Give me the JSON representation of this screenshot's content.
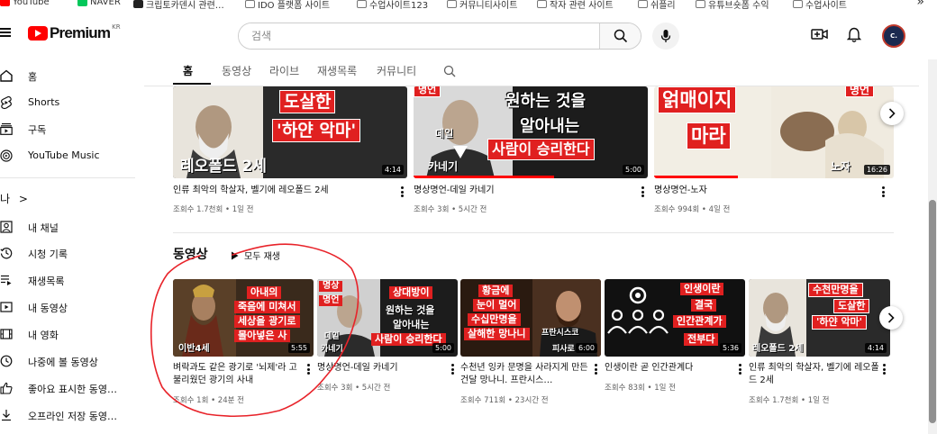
{
  "bookmarks": {
    "items": [
      {
        "label": "YouTube",
        "icon": "youtube-icon"
      },
      {
        "label": "NAVER",
        "icon": "naver-icon"
      },
      {
        "label": "크립토카덴시 관련…",
        "icon": "bookmark-icon"
      },
      {
        "label": "IDO 플랫폼 사이트",
        "icon": "folder-icon"
      },
      {
        "label": "수업사이트123",
        "icon": "folder-icon"
      },
      {
        "label": "커뮤니티사이트",
        "icon": "folder-icon"
      },
      {
        "label": "작자 관련 사이트",
        "icon": "folder-icon"
      },
      {
        "label": "쉬플리",
        "icon": "folder-icon"
      },
      {
        "label": "유튜브숏폼 수익",
        "icon": "folder-icon"
      },
      {
        "label": "수업사이트",
        "icon": "folder-icon"
      }
    ],
    "more": "»"
  },
  "header": {
    "logo_text": "Premium",
    "logo_region": "KR",
    "search_placeholder": "검색",
    "avatar_text": "C."
  },
  "sidebar": {
    "top_items": [
      {
        "label": "홈",
        "icon": "home-icon"
      },
      {
        "label": "Shorts",
        "icon": "shorts-icon"
      },
      {
        "label": "구독",
        "icon": "subscriptions-icon"
      },
      {
        "label": "YouTube Music",
        "icon": "youtube-music-icon"
      }
    ],
    "you_label": "나",
    "you_chevron": ">",
    "you_items": [
      {
        "label": "내 채널",
        "icon": "channel-icon"
      },
      {
        "label": "시청 기록",
        "icon": "history-icon"
      },
      {
        "label": "재생목록",
        "icon": "playlists-icon"
      },
      {
        "label": "내 동영상",
        "icon": "your-videos-icon"
      },
      {
        "label": "내 영화",
        "icon": "movies-icon"
      },
      {
        "label": "나중에 볼 동영상",
        "icon": "watch-later-icon"
      },
      {
        "label": "좋아요 표시한 동영…",
        "icon": "liked-icon"
      },
      {
        "label": "오프라인 저장 동영…",
        "icon": "download-icon"
      }
    ]
  },
  "tabs": [
    {
      "label": "홈",
      "active": true
    },
    {
      "label": "동영상",
      "active": false
    },
    {
      "label": "라이브",
      "active": false
    },
    {
      "label": "재생목록",
      "active": false
    },
    {
      "label": "커뮤니티",
      "active": false
    }
  ],
  "top_row": [
    {
      "thumb_lines": [
        "도살한",
        "'하얀 악마'",
        "레오폴드 2세"
      ],
      "duration": "4:14",
      "title": "인류 최악의 학살자, 벨기에 레오폴드 2세",
      "meta": "조회수 1.7천회 • 1일 전",
      "progress": 0.0
    },
    {
      "thumb_lines": [
        "원하는 것을",
        "알아내는",
        "사람이 승리한다",
        "데일",
        "카네기",
        "명언"
      ],
      "duration": "5:00",
      "title": "명상명언-데일 카네기",
      "meta": "조회수 3회 • 5시간 전",
      "progress": 0.6
    },
    {
      "thumb_lines": [
        "얽매이지",
        "마라",
        "노자",
        "명언"
      ],
      "duration": "16:26",
      "title": "명상명언-노자",
      "meta": "조회수 994회 • 4일 전",
      "progress": 0.35
    }
  ],
  "videos_section": {
    "title": "동영상",
    "play_all": "모두 재생"
  },
  "bottom_row": [
    {
      "thumb_lines": [
        "아내의",
        "죽음에 미쳐서",
        "세상을 광기로",
        "몰아넣은 사",
        "이반4세"
      ],
      "duration": "5:55",
      "title": "벼락과도 같은 광기로 '뇌제'라 고 불리웠던 광기의 사내",
      "meta": "조회수 1회 • 24분 전"
    },
    {
      "thumb_lines": [
        "명상",
        "명언",
        "상대방이",
        "원하는 것을",
        "알아내는",
        "사람이 승리한다",
        "데일",
        "카네기"
      ],
      "duration": "5:00",
      "title": "명상명언-데일 카네기",
      "meta": "조회수 3회 • 5시간 전"
    },
    {
      "thumb_lines": [
        "황금에",
        "눈이 멀어",
        "수십만명을",
        "살해한 망나니",
        "프란시스코",
        "피사로"
      ],
      "duration": "6:00",
      "title": "수천년 잉카 문명을 사라지게 만든 건달 망나니. 프란시스…",
      "meta": "조회수 711회 • 23시간 전"
    },
    {
      "thumb_lines": [
        "인생이란",
        "결국",
        "인간관계가",
        "전부다"
      ],
      "duration": "5:36",
      "title": "인생이란 곧 인간관계다",
      "meta": "조회수 83회 • 1일 전"
    },
    {
      "thumb_lines": [
        "수천만명을",
        "도살한",
        "'하얀 악마'",
        "레오폴드 2세"
      ],
      "duration": "4:14",
      "title": "인류 최악의 학살자, 벨기에 레오폴드 2세",
      "meta": "조회수 1.7천회 • 1일 전"
    }
  ],
  "colors": {
    "youtube_red": "#ff0000",
    "thumb_red": "#e02020",
    "annotation_red": "#e8232a",
    "text_primary": "#0f0f0f",
    "text_secondary": "#606060"
  }
}
